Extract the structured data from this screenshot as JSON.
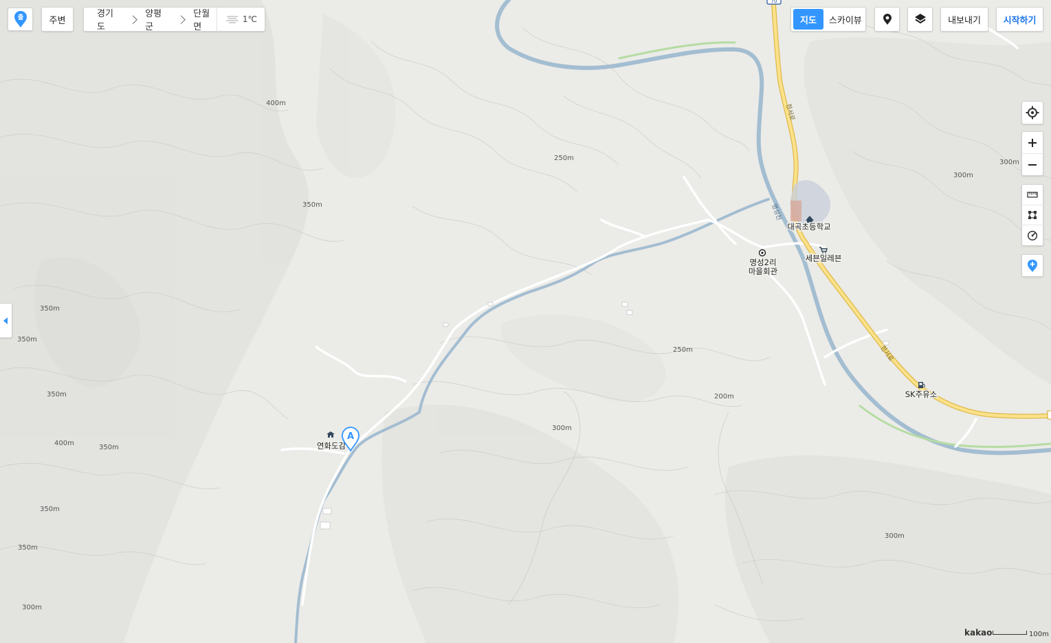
{
  "toolbar": {
    "logo_glyph": "출",
    "nearby_label": "주변",
    "breadcrumb": [
      "경기도",
      "양평군",
      "단월면"
    ],
    "weather_temp": "1℃",
    "maptype_map_label": "지도",
    "maptype_skyview_label": "스카이뷰",
    "export_label": "내보내기",
    "start_label": "시작하기"
  },
  "map": {
    "elevation_labels": [
      "400m",
      "350m",
      "250m",
      "300m",
      "300m",
      "350m",
      "350m",
      "350m",
      "400m",
      "350m",
      "350m",
      "350m",
      "300m",
      "250m",
      "200m",
      "300m",
      "300m"
    ],
    "pois": {
      "school": "대곡초등학교",
      "hall_line1": "명성2리",
      "hall_line2": "마을회관",
      "store": "세븐일레븐",
      "gas_station": "SK주유소",
      "temple": "연화도감"
    },
    "marker_letter": "A",
    "river_name": "명성천",
    "road_name": "한서로",
    "route_number": "70"
  },
  "footer": {
    "brand": "kakao",
    "scale_label": "100m"
  },
  "colors": {
    "accent": "#3396ff",
    "river": "#a3bdd1",
    "road_main": "#f5d26a",
    "land": "#e9e9e6"
  }
}
